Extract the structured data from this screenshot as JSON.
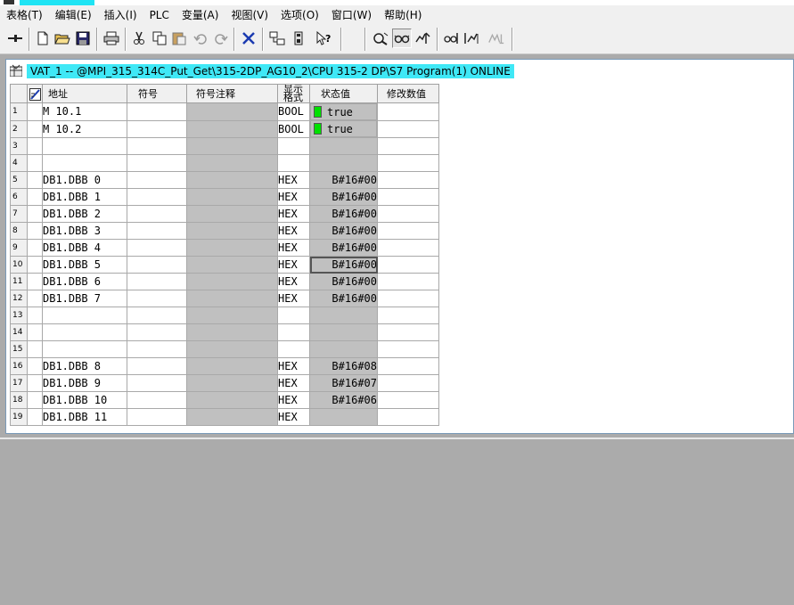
{
  "titlebar": {
    "accent": "#1fe4f4"
  },
  "menu": [
    "表格(T)",
    "编辑(E)",
    "插入(I)",
    "PLC",
    "变量(A)",
    "视图(V)",
    "选项(O)",
    "窗口(W)",
    "帮助(H)"
  ],
  "toolbar": {
    "buttons": [
      "pin-icon",
      "new-document-icon",
      "open-folder-icon",
      "save-icon",
      "print-icon",
      "cut-icon",
      "copy-icon",
      "paste-icon",
      "undo-icon",
      "redo-icon",
      "delete-icon",
      "network-icon",
      "cpu-icon",
      "help-pointer-icon",
      "monitor-icon",
      "monitor-glasses-icon",
      "modify-icon",
      "monitor-update-icon",
      "trigger-modify-icon",
      "force-icon"
    ]
  },
  "window": {
    "title": "VAT_1 -- @MPI_315_314C_Put_Get\\315-2DP_AG10_2\\CPU 315-2 DP\\S7 Program(1)  ONLINE",
    "title_bg": "#3fe8f6"
  },
  "table": {
    "headers": {
      "address": "地址",
      "symbol": "符号",
      "symbol_comment": "符号注释",
      "display_format": "显示格式",
      "status_value": "状态值",
      "modify_value": "修改数值"
    },
    "rows": [
      {
        "num": "1",
        "address": "M     10.1",
        "format": "BOOL",
        "status": "true",
        "led": true
      },
      {
        "num": "2",
        "address": "M     10.2",
        "format": "BOOL",
        "status": "true",
        "led": true
      },
      {
        "num": "3",
        "address": "",
        "format": "",
        "status": ""
      },
      {
        "num": "4",
        "address": "",
        "format": "",
        "status": ""
      },
      {
        "num": "5",
        "address": "DB1.DBB    0",
        "format": "HEX",
        "status": "B#16#00"
      },
      {
        "num": "6",
        "address": "DB1.DBB    1",
        "format": "HEX",
        "status": "B#16#00"
      },
      {
        "num": "7",
        "address": "DB1.DBB    2",
        "format": "HEX",
        "status": "B#16#00"
      },
      {
        "num": "8",
        "address": "DB1.DBB    3",
        "format": "HEX",
        "status": "B#16#00"
      },
      {
        "num": "9",
        "address": "DB1.DBB    4",
        "format": "HEX",
        "status": "B#16#00"
      },
      {
        "num": "10",
        "address": "DB1.DBB    5",
        "format": "HEX",
        "status": "B#16#00",
        "selected": true
      },
      {
        "num": "11",
        "address": "DB1.DBB    6",
        "format": "HEX",
        "status": "B#16#00"
      },
      {
        "num": "12",
        "address": "DB1.DBB    7",
        "format": "HEX",
        "status": "B#16#00"
      },
      {
        "num": "13",
        "address": "",
        "format": "",
        "status": ""
      },
      {
        "num": "14",
        "address": "",
        "format": "",
        "status": ""
      },
      {
        "num": "15",
        "address": "",
        "format": "",
        "status": ""
      },
      {
        "num": "16",
        "address": "DB1.DBB    8",
        "format": "HEX",
        "status": "B#16#08"
      },
      {
        "num": "17",
        "address": "DB1.DBB    9",
        "format": "HEX",
        "status": "B#16#07"
      },
      {
        "num": "18",
        "address": "DB1.DBB   10",
        "format": "HEX",
        "status": "B#16#06"
      },
      {
        "num": "19",
        "address": "DB1.DBB   11",
        "format": "HEX",
        "status": ""
      }
    ]
  },
  "colors": {
    "led_on": "#00e000",
    "status_bg": "#c0c0c0",
    "workspace": "#ababab"
  }
}
